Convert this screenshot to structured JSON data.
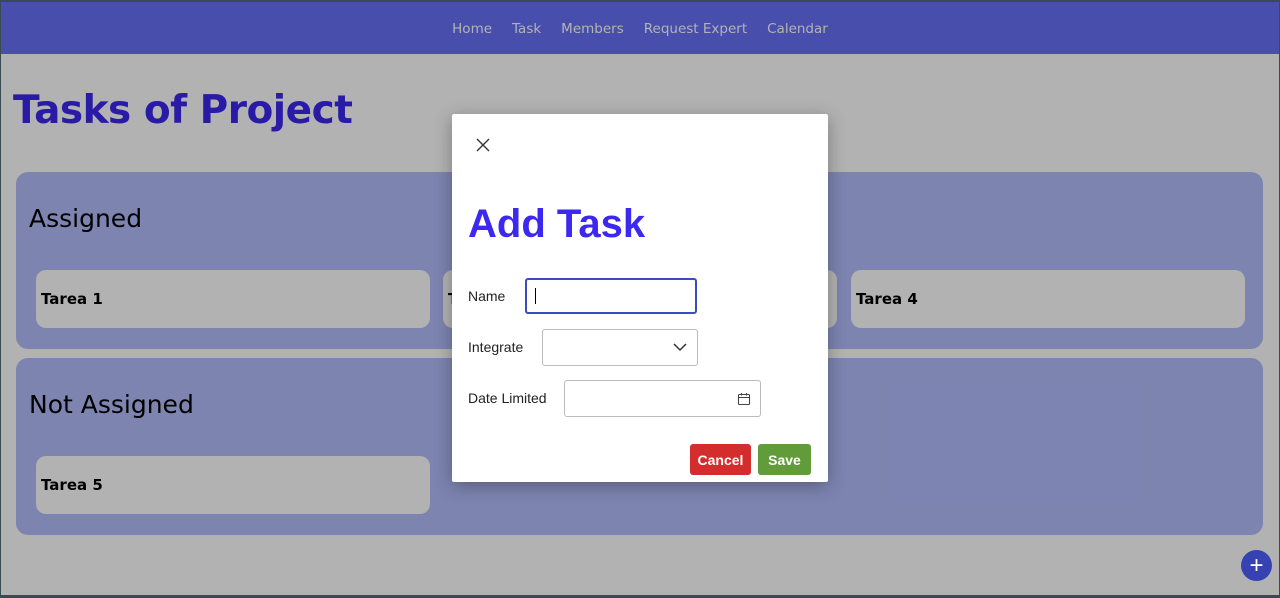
{
  "nav": {
    "links": [
      "Home",
      "Task",
      "Members",
      "Request Expert",
      "Calendar"
    ]
  },
  "page": {
    "title": "Tasks of Project"
  },
  "sections": {
    "assigned": {
      "title": "Assigned",
      "cards": [
        "Tarea 1",
        "T",
        "",
        "Tarea 4"
      ]
    },
    "not_assigned": {
      "title": "Not Assigned",
      "cards": [
        "Tarea 5"
      ]
    }
  },
  "fab": {
    "label": "+",
    "icon": "plus-icon"
  },
  "modal": {
    "title": "Add Task",
    "close_icon": "close-icon",
    "name_label": "Name",
    "name_value": "",
    "integrate_label": "Integrate",
    "integrate_value": "",
    "date_label": "Date Limited",
    "date_value": "",
    "cancel_label": "Cancel",
    "save_label": "Save"
  },
  "colors": {
    "navbar": "#6670f5",
    "accent_title": "#3c28ee",
    "section_bg": "#b3bdfd",
    "cancel": "#d42d2d",
    "save": "#629b3a",
    "fab": "#3642b2"
  }
}
